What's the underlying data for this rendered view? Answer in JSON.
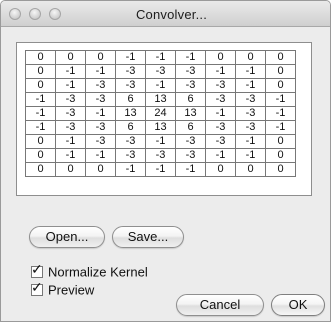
{
  "window": {
    "title": "Convolver..."
  },
  "kernel": {
    "rows": [
      [
        "0",
        "0",
        "0",
        "-1",
        "-1",
        "-1",
        "0",
        "0",
        "0"
      ],
      [
        "0",
        "-1",
        "-1",
        "-3",
        "-3",
        "-3",
        "-1",
        "-1",
        "0"
      ],
      [
        "0",
        "-1",
        "-3",
        "-3",
        "-1",
        "-3",
        "-3",
        "-1",
        "0"
      ],
      [
        "-1",
        "-3",
        "-3",
        "6",
        "13",
        "6",
        "-3",
        "-3",
        "-1"
      ],
      [
        "-1",
        "-3",
        "-1",
        "13",
        "24",
        "13",
        "-1",
        "-3",
        "-1"
      ],
      [
        "-1",
        "-3",
        "-3",
        "6",
        "13",
        "6",
        "-3",
        "-3",
        "-1"
      ],
      [
        "0",
        "-1",
        "-3",
        "-3",
        "-1",
        "-3",
        "-3",
        "-1",
        "0"
      ],
      [
        "0",
        "-1",
        "-1",
        "-3",
        "-3",
        "-3",
        "-1",
        "-1",
        "0"
      ],
      [
        "0",
        "0",
        "0",
        "-1",
        "-1",
        "-1",
        "0",
        "0",
        "0"
      ]
    ]
  },
  "buttons": {
    "open": "Open...",
    "save": "Save...",
    "cancel": "Cancel",
    "ok": "OK"
  },
  "options": {
    "normalize_label": "Normalize Kernel",
    "normalize_checked": true,
    "preview_label": "Preview",
    "preview_checked": true
  }
}
